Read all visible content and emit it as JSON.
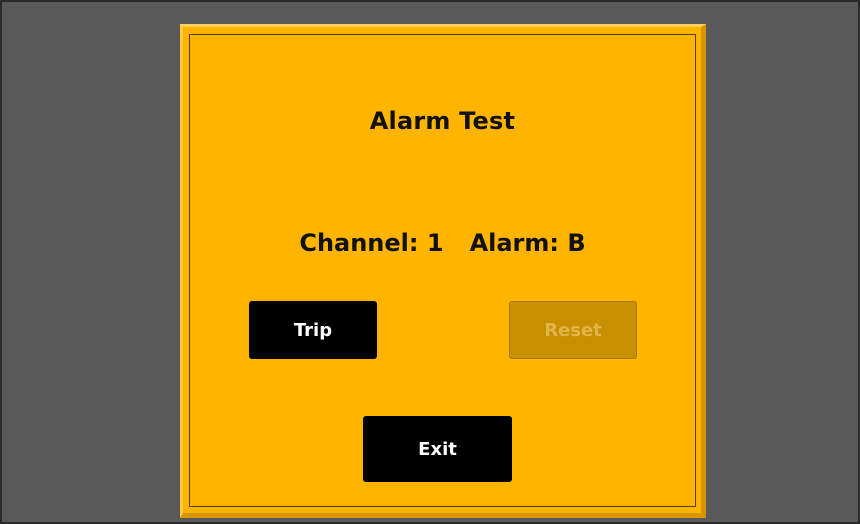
{
  "dialog": {
    "title": "Alarm Test",
    "channel_label": "Channel:",
    "channel_value": "1",
    "alarm_label": "Alarm:",
    "alarm_value": "B"
  },
  "buttons": {
    "trip": {
      "label": "Trip",
      "enabled": true
    },
    "reset": {
      "label": "Reset",
      "enabled": false
    },
    "exit": {
      "label": "Exit",
      "enabled": true
    }
  },
  "colors": {
    "background": "#595959",
    "dialog": "#ffb400",
    "button": "#000000",
    "button_text": "#ffffff",
    "disabled_button": "#c88f00",
    "disabled_text": "#e2b54a"
  }
}
